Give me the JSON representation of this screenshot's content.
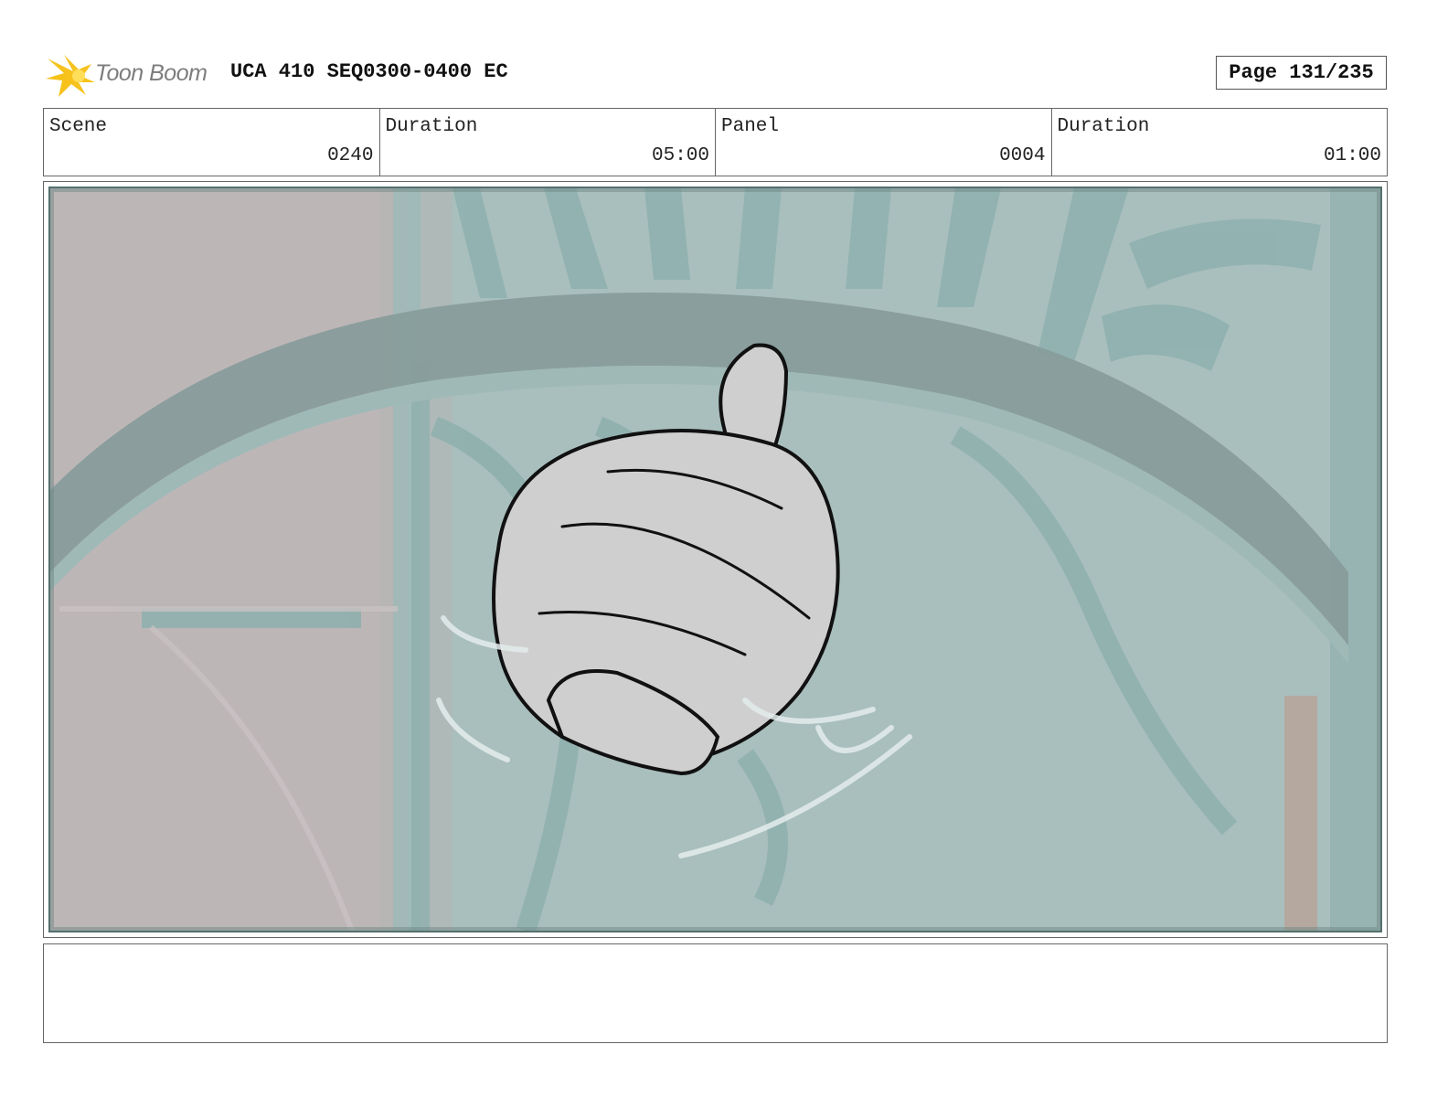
{
  "header": {
    "logo_text": "Toon Boom",
    "doc_title": "UCA 410 SEQ0300-0400 EC",
    "page_label": "Page 131/235"
  },
  "info": {
    "scene_label": "Scene",
    "scene_value": "0240",
    "scene_duration_label": "Duration",
    "scene_duration_value": "05:00",
    "panel_label": "Panel",
    "panel_value": "0004",
    "panel_duration_label": "Duration",
    "panel_duration_value": "01:00"
  },
  "panel": {
    "image_icon": "storyboard-sketch-image"
  },
  "notes": {
    "text": ""
  },
  "colors": {
    "logo_yellow": "#f6c21b",
    "teal_structure": "#94b5b3",
    "wall_gray": "#bcb5b6",
    "sketch_fill": "#cfcfcf"
  }
}
